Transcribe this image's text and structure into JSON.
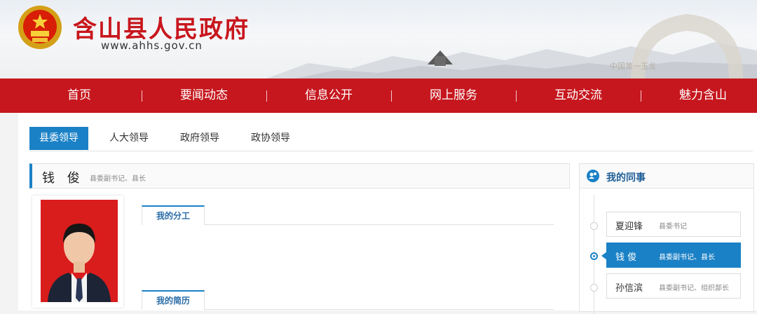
{
  "header": {
    "site_name": "含山县人民政府",
    "site_url": "www.ahhs.gov.cn",
    "watermark": "中国第一玉龙"
  },
  "nav": {
    "items": [
      {
        "label": "首页"
      },
      {
        "label": "要闻动态"
      },
      {
        "label": "信息公开"
      },
      {
        "label": "网上服务"
      },
      {
        "label": "互动交流"
      },
      {
        "label": "魅力含山"
      }
    ]
  },
  "tabs": [
    {
      "label": "县委领导",
      "active": true
    },
    {
      "label": "人大领导",
      "active": false
    },
    {
      "label": "政府领导",
      "active": false
    },
    {
      "label": "政协领导",
      "active": false
    }
  ],
  "profile": {
    "name": "钱 俊",
    "title": "县委副书记、县长",
    "sections": [
      {
        "label": "我的分工"
      },
      {
        "label": "我的简历"
      }
    ]
  },
  "colleagues": {
    "title": "我的同事",
    "items": [
      {
        "name": "夏迎锋",
        "role": "县委书记",
        "active": false
      },
      {
        "name": "钱 俊",
        "role": "县委副书记、县长",
        "active": true
      },
      {
        "name": "孙信滨",
        "role": "县委副书记、组织部长",
        "active": false
      }
    ]
  },
  "colors": {
    "nav_red": "#c6171e",
    "brand_red": "#c8161d",
    "accent_blue": "#1b81c6"
  }
}
